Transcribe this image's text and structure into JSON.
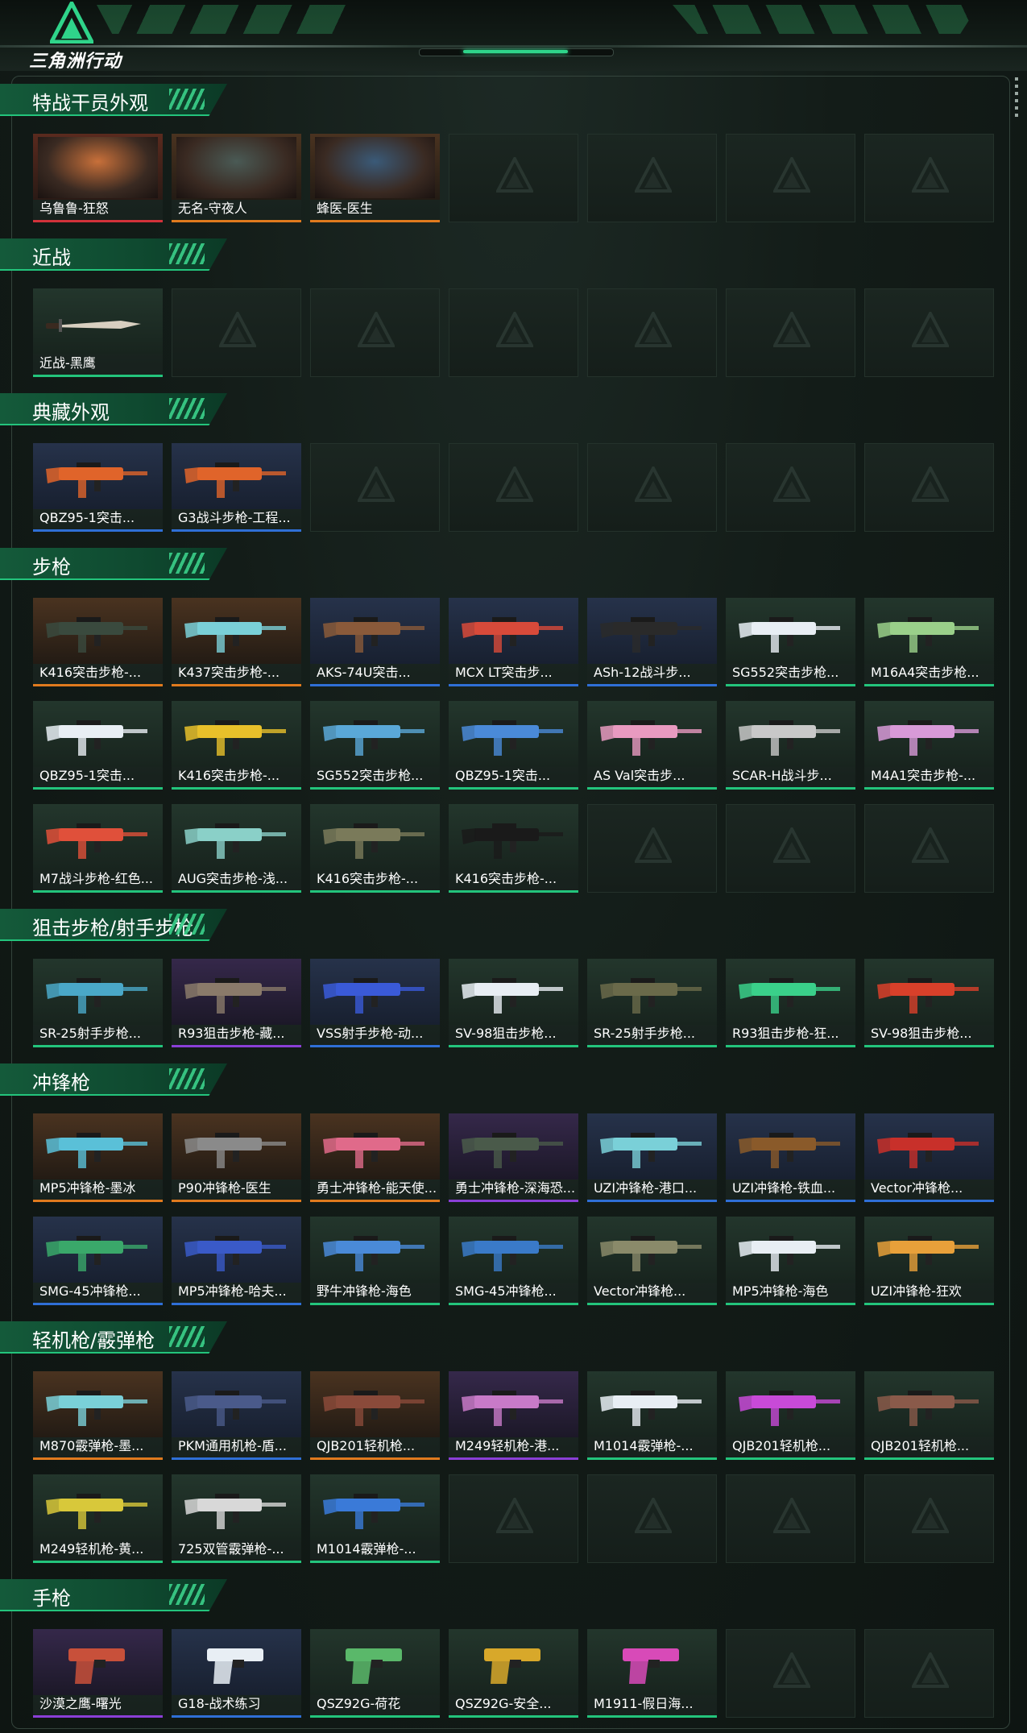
{
  "app": {
    "logo_text": "三角洲行动"
  },
  "sections": [
    {
      "key": "operators",
      "title": "特战干员外观",
      "slots": 7,
      "items": [
        {
          "label": "乌鲁鲁-狂怒",
          "quality": "red",
          "kind": "operator",
          "color": "#c8703a"
        },
        {
          "label": "无名-守夜人",
          "quality": "orange",
          "kind": "operator",
          "color": "#4a5a55"
        },
        {
          "label": "蜂医-医生",
          "quality": "orange",
          "kind": "operator",
          "color": "#3a5a78"
        }
      ]
    },
    {
      "key": "melee",
      "title": "近战",
      "slots": 7,
      "items": [
        {
          "label": "近战-黑鹰",
          "quality": "green",
          "kind": "knife",
          "color": "#d8cfc0"
        }
      ]
    },
    {
      "key": "collection",
      "title": "典藏外观",
      "slots": 7,
      "items": [
        {
          "label": "QBZ95-1突击...",
          "quality": "blue",
          "kind": "gun",
          "color": "#e0642a"
        },
        {
          "label": "G3战斗步枪-工程...",
          "quality": "blue",
          "kind": "gun",
          "color": "#e0642a"
        }
      ]
    },
    {
      "key": "rifles",
      "title": "步枪",
      "slots": 21,
      "items": [
        {
          "label": "K416突击步枪-...",
          "quality": "orange",
          "kind": "gun",
          "color": "#3a4a3e"
        },
        {
          "label": "K437突击步枪-...",
          "quality": "orange",
          "kind": "gun",
          "color": "#7ad0d8"
        },
        {
          "label": "AKS-74U突击...",
          "quality": "blue",
          "kind": "gun",
          "color": "#8a5a3a"
        },
        {
          "label": "MCX LT突击步...",
          "quality": "blue",
          "kind": "gun",
          "color": "#d84a3a"
        },
        {
          "label": "ASh-12战斗步...",
          "quality": "blue",
          "kind": "gun",
          "color": "#2a2a2a"
        },
        {
          "label": "SG552突击步枪...",
          "quality": "green",
          "kind": "gun",
          "color": "#e8eef4"
        },
        {
          "label": "M16A4突击步枪...",
          "quality": "green",
          "kind": "gun",
          "color": "#9ad08a"
        },
        {
          "label": "QBZ95-1突击...",
          "quality": "green",
          "kind": "gun",
          "color": "#e8eef4"
        },
        {
          "label": "K416突击步枪-...",
          "quality": "green",
          "kind": "gun",
          "color": "#e8c02a"
        },
        {
          "label": "SG552突击步枪...",
          "quality": "green",
          "kind": "gun",
          "color": "#5aa8d8"
        },
        {
          "label": "QBZ95-1突击...",
          "quality": "green",
          "kind": "gun",
          "color": "#4a8ad8"
        },
        {
          "label": "AS Val突击步...",
          "quality": "green",
          "kind": "gun",
          "color": "#e89ac0"
        },
        {
          "label": "SCAR-H战斗步...",
          "quality": "green",
          "kind": "gun",
          "color": "#c8c8c8"
        },
        {
          "label": "M4A1突击步枪-...",
          "quality": "green",
          "kind": "gun",
          "color": "#d89ad8"
        },
        {
          "label": "M7战斗步枪-红色...",
          "quality": "green",
          "kind": "gun",
          "color": "#e0503a"
        },
        {
          "label": "AUG突击步枪-浅...",
          "quality": "green",
          "kind": "gun",
          "color": "#8ad0c8"
        },
        {
          "label": "K416突击步枪-...",
          "quality": "green",
          "kind": "gun",
          "color": "#7a7a5a"
        },
        {
          "label": "K416突击步枪-...",
          "quality": "green",
          "kind": "gun",
          "color": "#1a1a1a"
        }
      ]
    },
    {
      "key": "snipers",
      "title": "狙击步枪/射手步枪",
      "slots": 7,
      "items": [
        {
          "label": "SR-25射手步枪...",
          "quality": "green",
          "kind": "gun",
          "color": "#4aa8c8"
        },
        {
          "label": "R93狙击步枪-藏...",
          "quality": "purple",
          "kind": "gun",
          "color": "#8a7a6a"
        },
        {
          "label": "VSS射手步枪-动...",
          "quality": "blue",
          "kind": "gun",
          "color": "#3a5ad8"
        },
        {
          "label": "SV-98狙击步枪...",
          "quality": "green",
          "kind": "gun",
          "color": "#e8eef4"
        },
        {
          "label": "SR-25射手步枪...",
          "quality": "green",
          "kind": "gun",
          "color": "#6a6a4a"
        },
        {
          "label": "R93狙击步枪-狂...",
          "quality": "green",
          "kind": "gun",
          "color": "#3ad08a"
        },
        {
          "label": "SV-98狙击步枪...",
          "quality": "green",
          "kind": "gun",
          "color": "#d8402a"
        }
      ]
    },
    {
      "key": "smgs",
      "title": "冲锋枪",
      "slots": 14,
      "items": [
        {
          "label": "MP5冲锋枪-墨冰",
          "quality": "orange",
          "kind": "gun",
          "color": "#5ac0d8"
        },
        {
          "label": "P90冲锋枪-医生",
          "quality": "orange",
          "kind": "gun",
          "color": "#8a8a8a"
        },
        {
          "label": "勇士冲锋枪-能天使...",
          "quality": "orange",
          "kind": "gun",
          "color": "#e06a8a"
        },
        {
          "label": "勇士冲锋枪-深海恐...",
          "quality": "purple",
          "kind": "gun",
          "color": "#4a5a4a"
        },
        {
          "label": "UZI冲锋枪-港口...",
          "quality": "blue",
          "kind": "gun",
          "color": "#7ad0d8"
        },
        {
          "label": "UZI冲锋枪-铁血...",
          "quality": "blue",
          "kind": "gun",
          "color": "#8a5a2a"
        },
        {
          "label": "Vector冲锋枪...",
          "quality": "blue",
          "kind": "gun",
          "color": "#c8302a"
        },
        {
          "label": "SMG-45冲锋枪...",
          "quality": "blue",
          "kind": "gun",
          "color": "#3aa86a"
        },
        {
          "label": "MP5冲锋枪-哈夫...",
          "quality": "blue",
          "kind": "gun",
          "color": "#3a5ac8"
        },
        {
          "label": "野牛冲锋枪-海色",
          "quality": "green",
          "kind": "gun",
          "color": "#4a8ad8"
        },
        {
          "label": "SMG-45冲锋枪...",
          "quality": "green",
          "kind": "gun",
          "color": "#3a7ac8"
        },
        {
          "label": "Vector冲锋枪...",
          "quality": "green",
          "kind": "gun",
          "color": "#8a8a6a"
        },
        {
          "label": "MP5冲锋枪-海色",
          "quality": "green",
          "kind": "gun",
          "color": "#e8eef4"
        },
        {
          "label": "UZI冲锋枪-狂欢",
          "quality": "green",
          "kind": "gun",
          "color": "#e8a03a"
        }
      ]
    },
    {
      "key": "lmgs",
      "title": "轻机枪/霰弹枪",
      "slots": 14,
      "items": [
        {
          "label": "M870霰弹枪-墨...",
          "quality": "orange",
          "kind": "gun",
          "color": "#7ad0d8"
        },
        {
          "label": "PKM通用机枪-盾...",
          "quality": "blue",
          "kind": "gun",
          "color": "#4a5a8a"
        },
        {
          "label": "QJB201轻机枪...",
          "quality": "orange",
          "kind": "gun",
          "color": "#8a4a3a"
        },
        {
          "label": "M249轻机枪-港...",
          "quality": "purple",
          "kind": "gun",
          "color": "#c87ac8"
        },
        {
          "label": "M1014霰弹枪-...",
          "quality": "green",
          "kind": "gun",
          "color": "#e8eef4"
        },
        {
          "label": "QJB201轻机枪...",
          "quality": "green",
          "kind": "gun",
          "color": "#c84ad8"
        },
        {
          "label": "QJB201轻机枪...",
          "quality": "green",
          "kind": "gun",
          "color": "#8a5a4a"
        },
        {
          "label": "M249轻机枪-黄...",
          "quality": "green",
          "kind": "gun",
          "color": "#d8c83a"
        },
        {
          "label": "725双管霰弹枪-...",
          "quality": "green",
          "kind": "gun",
          "color": "#d8d8d8"
        },
        {
          "label": "M1014霰弹枪-...",
          "quality": "green",
          "kind": "gun",
          "color": "#3a7ad8"
        }
      ]
    },
    {
      "key": "pistols",
      "title": "手枪",
      "slots": 7,
      "items": [
        {
          "label": "沙漠之鹰-曙光",
          "quality": "purple",
          "kind": "pistol",
          "color": "#c8503a"
        },
        {
          "label": "G18-战术练习",
          "quality": "blue",
          "kind": "pistol",
          "color": "#e8eef4"
        },
        {
          "label": "QSZ92G-荷花",
          "quality": "green",
          "kind": "pistol",
          "color": "#5ab86a"
        },
        {
          "label": "QSZ92G-安全...",
          "quality": "green",
          "kind": "pistol",
          "color": "#d8a82a"
        },
        {
          "label": "M1911-假日海...",
          "quality": "green",
          "kind": "pistol",
          "color": "#d84ab8"
        }
      ]
    }
  ]
}
